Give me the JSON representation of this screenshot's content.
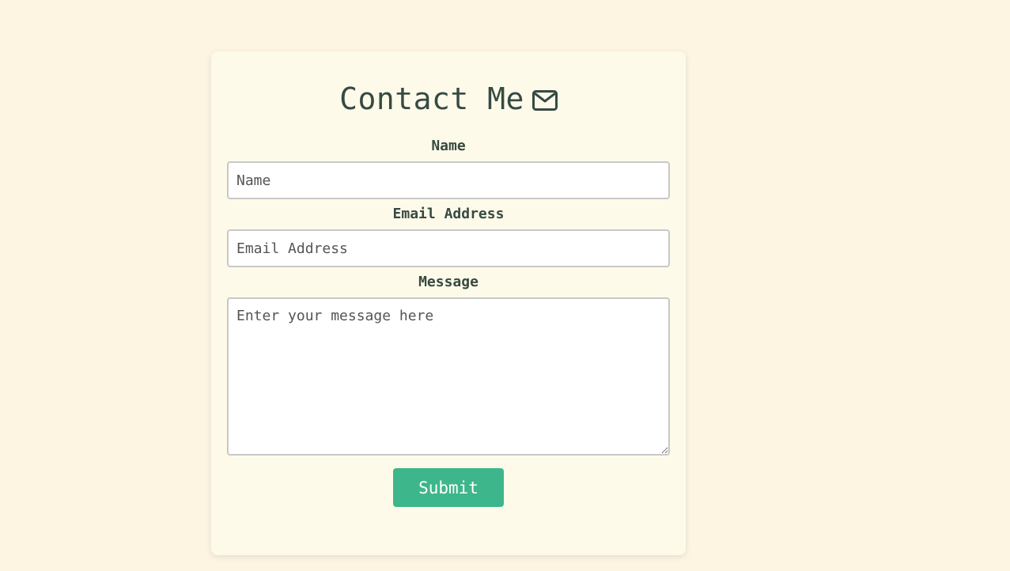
{
  "form": {
    "title": "Contact Me",
    "title_icon": "envelope-icon",
    "fields": {
      "name": {
        "label": "Name",
        "placeholder": "Name",
        "value": ""
      },
      "email": {
        "label": "Email Address",
        "placeholder": "Email Address",
        "value": ""
      },
      "message": {
        "label": "Message",
        "placeholder": "Enter your message here",
        "value": ""
      }
    },
    "submit_label": "Submit"
  },
  "colors": {
    "page_background": "#fdf5e2",
    "card_background": "#fefae9",
    "text": "#364a43",
    "accent": "#3db68b"
  }
}
